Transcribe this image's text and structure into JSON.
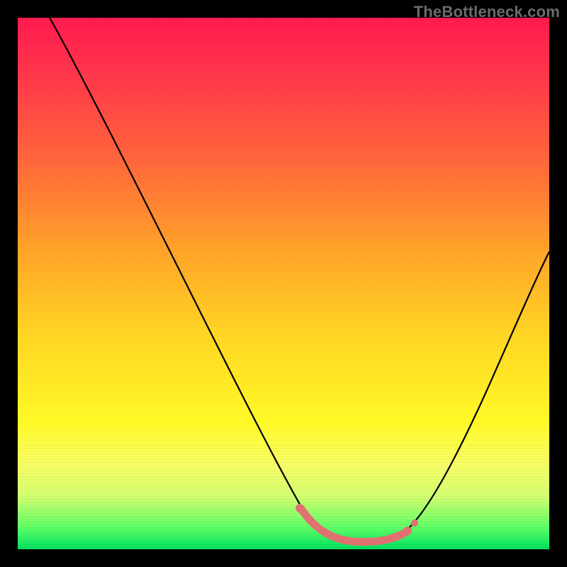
{
  "watermark": "TheBottleneck.com",
  "chart_data": {
    "type": "line",
    "title": "",
    "xlabel": "",
    "ylabel": "",
    "xlim": [
      0,
      100
    ],
    "ylim": [
      0,
      100
    ],
    "series": [
      {
        "name": "bottleneck-curve",
        "x": [
          6,
          12,
          20,
          28,
          36,
          44,
          50,
          54,
          58,
          62,
          66,
          70,
          74,
          80,
          88,
          96,
          100
        ],
        "y": [
          100,
          88,
          74,
          60,
          46,
          32,
          20,
          12,
          6,
          3,
          2,
          2,
          3,
          10,
          26,
          44,
          54
        ]
      }
    ],
    "highlight": {
      "name": "optimal-range",
      "x": [
        54,
        72
      ],
      "y": [
        3,
        3
      ]
    },
    "background_gradient": {
      "top": "#ff1a4f",
      "mid": "#fff826",
      "bottom": "#00e060"
    }
  }
}
